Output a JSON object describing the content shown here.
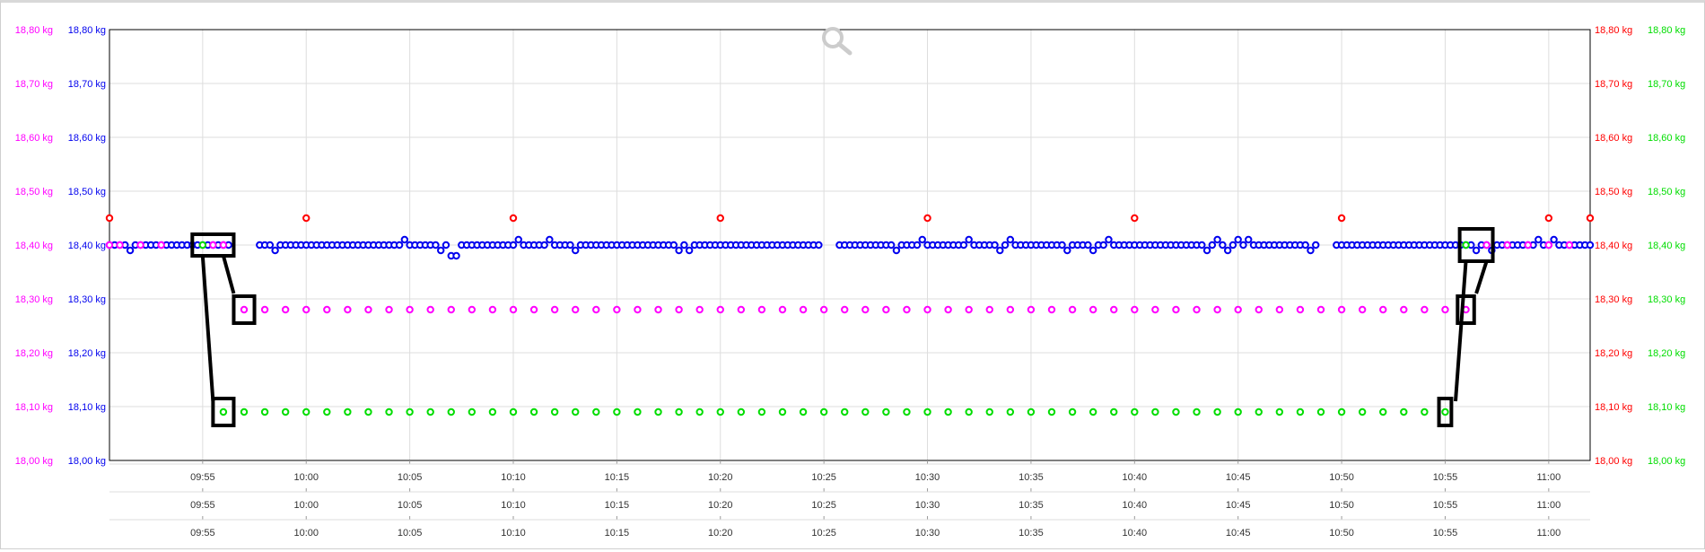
{
  "colors": {
    "axis_left_outer": "#ff00ff",
    "axis_left_inner": "#0000ee",
    "axis_right_inner": "#ff0000",
    "axis_right_outer": "#00dd00",
    "series_blue": "#0000ee",
    "series_magenta": "#ff00ff",
    "series_green": "#00dd00",
    "series_red": "#ff0000",
    "annotation": "#000000",
    "grid": "#dddddd"
  },
  "icons": {
    "zoom": "magnifier-icon"
  },
  "chart_data": {
    "type": "scatter",
    "x_unit": "time",
    "x_range": [
      "09:50:30",
      "11:02:00"
    ],
    "x_ticks": [
      "09:55",
      "10:00",
      "10:05",
      "10:10",
      "10:15",
      "10:20",
      "10:25",
      "10:30",
      "10:35",
      "10:40",
      "10:45",
      "10:50",
      "10:55",
      "11:00"
    ],
    "x_axis_rows": 3,
    "y_range": [
      18.0,
      18.8
    ],
    "y_ticks": [
      "18,00 kg",
      "18,10 kg",
      "18,20 kg",
      "18,30 kg",
      "18,40 kg",
      "18,50 kg",
      "18,60 kg",
      "18,70 kg",
      "18,80 kg"
    ],
    "y_axes": [
      {
        "side": "left",
        "position": "outer",
        "color": "#ff00ff"
      },
      {
        "side": "left",
        "position": "inner",
        "color": "#0000ee"
      },
      {
        "side": "right",
        "position": "inner",
        "color": "#ff0000"
      },
      {
        "side": "right",
        "position": "outer",
        "color": "#00dd00"
      }
    ],
    "grid": true,
    "legend": "none",
    "series": [
      {
        "color": "#ff0000",
        "marker": "circle",
        "points": [
          [
            "09:50:30",
            18.45
          ],
          [
            "10:00:00",
            18.45
          ],
          [
            "10:10:00",
            18.45
          ],
          [
            "10:20:00",
            18.45
          ],
          [
            "10:30:00",
            18.45
          ],
          [
            "10:40:00",
            18.45
          ],
          [
            "10:50:00",
            18.45
          ],
          [
            "11:00:00",
            18.45
          ],
          [
            "11:02:00",
            18.45
          ]
        ]
      },
      {
        "color": "#ff00ff",
        "marker": "circle",
        "points": [
          [
            "09:50:30",
            18.4
          ],
          [
            "09:51:00",
            18.4
          ],
          [
            "09:52:00",
            18.4
          ],
          [
            "09:53:00",
            18.4
          ],
          [
            "09:55:30",
            18.4
          ],
          [
            "09:56:00",
            18.4
          ],
          [
            "09:57:00",
            18.28
          ],
          [
            "09:58:00",
            18.28
          ],
          [
            "09:59:00",
            18.28
          ],
          [
            "10:00:00",
            18.28
          ],
          [
            "10:01:00",
            18.28
          ],
          [
            "10:02:00",
            18.28
          ],
          [
            "10:03:00",
            18.28
          ],
          [
            "10:04:00",
            18.28
          ],
          [
            "10:05:00",
            18.28
          ],
          [
            "10:06:00",
            18.28
          ],
          [
            "10:07:00",
            18.28
          ],
          [
            "10:08:00",
            18.28
          ],
          [
            "10:09:00",
            18.28
          ],
          [
            "10:10:00",
            18.28
          ],
          [
            "10:11:00",
            18.28
          ],
          [
            "10:12:00",
            18.28
          ],
          [
            "10:13:00",
            18.28
          ],
          [
            "10:14:00",
            18.28
          ],
          [
            "10:15:00",
            18.28
          ],
          [
            "10:16:00",
            18.28
          ],
          [
            "10:17:00",
            18.28
          ],
          [
            "10:18:00",
            18.28
          ],
          [
            "10:19:00",
            18.28
          ],
          [
            "10:20:00",
            18.28
          ],
          [
            "10:21:00",
            18.28
          ],
          [
            "10:22:00",
            18.28
          ],
          [
            "10:23:00",
            18.28
          ],
          [
            "10:24:00",
            18.28
          ],
          [
            "10:25:00",
            18.28
          ],
          [
            "10:26:00",
            18.28
          ],
          [
            "10:27:00",
            18.28
          ],
          [
            "10:28:00",
            18.28
          ],
          [
            "10:29:00",
            18.28
          ],
          [
            "10:30:00",
            18.28
          ],
          [
            "10:31:00",
            18.28
          ],
          [
            "10:32:00",
            18.28
          ],
          [
            "10:33:00",
            18.28
          ],
          [
            "10:34:00",
            18.28
          ],
          [
            "10:35:00",
            18.28
          ],
          [
            "10:36:00",
            18.28
          ],
          [
            "10:37:00",
            18.28
          ],
          [
            "10:38:00",
            18.28
          ],
          [
            "10:39:00",
            18.28
          ],
          [
            "10:40:00",
            18.28
          ],
          [
            "10:41:00",
            18.28
          ],
          [
            "10:42:00",
            18.28
          ],
          [
            "10:43:00",
            18.28
          ],
          [
            "10:44:00",
            18.28
          ],
          [
            "10:45:00",
            18.28
          ],
          [
            "10:46:00",
            18.28
          ],
          [
            "10:47:00",
            18.28
          ],
          [
            "10:48:00",
            18.28
          ],
          [
            "10:49:00",
            18.28
          ],
          [
            "10:50:00",
            18.28
          ],
          [
            "10:51:00",
            18.28
          ],
          [
            "10:52:00",
            18.28
          ],
          [
            "10:53:00",
            18.28
          ],
          [
            "10:54:00",
            18.28
          ],
          [
            "10:55:00",
            18.28
          ],
          [
            "10:56:00",
            18.28
          ],
          [
            "10:57:00",
            18.4
          ],
          [
            "10:58:00",
            18.4
          ],
          [
            "10:59:00",
            18.4
          ],
          [
            "11:00:00",
            18.4
          ],
          [
            "11:01:00",
            18.4
          ]
        ]
      },
      {
        "color": "#00dd00",
        "marker": "circle",
        "points": [
          [
            "09:55:00",
            18.4
          ],
          [
            "09:56:00",
            18.09
          ],
          [
            "09:57:00",
            18.09
          ],
          [
            "09:58:00",
            18.09
          ],
          [
            "09:59:00",
            18.09
          ],
          [
            "10:00:00",
            18.09
          ],
          [
            "10:01:00",
            18.09
          ],
          [
            "10:02:00",
            18.09
          ],
          [
            "10:03:00",
            18.09
          ],
          [
            "10:04:00",
            18.09
          ],
          [
            "10:05:00",
            18.09
          ],
          [
            "10:06:00",
            18.09
          ],
          [
            "10:07:00",
            18.09
          ],
          [
            "10:08:00",
            18.09
          ],
          [
            "10:09:00",
            18.09
          ],
          [
            "10:10:00",
            18.09
          ],
          [
            "10:11:00",
            18.09
          ],
          [
            "10:12:00",
            18.09
          ],
          [
            "10:13:00",
            18.09
          ],
          [
            "10:14:00",
            18.09
          ],
          [
            "10:15:00",
            18.09
          ],
          [
            "10:16:00",
            18.09
          ],
          [
            "10:17:00",
            18.09
          ],
          [
            "10:18:00",
            18.09
          ],
          [
            "10:19:00",
            18.09
          ],
          [
            "10:20:00",
            18.09
          ],
          [
            "10:21:00",
            18.09
          ],
          [
            "10:22:00",
            18.09
          ],
          [
            "10:23:00",
            18.09
          ],
          [
            "10:24:00",
            18.09
          ],
          [
            "10:25:00",
            18.09
          ],
          [
            "10:26:00",
            18.09
          ],
          [
            "10:27:00",
            18.09
          ],
          [
            "10:28:00",
            18.09
          ],
          [
            "10:29:00",
            18.09
          ],
          [
            "10:30:00",
            18.09
          ],
          [
            "10:31:00",
            18.09
          ],
          [
            "10:32:00",
            18.09
          ],
          [
            "10:33:00",
            18.09
          ],
          [
            "10:34:00",
            18.09
          ],
          [
            "10:35:00",
            18.09
          ],
          [
            "10:36:00",
            18.09
          ],
          [
            "10:37:00",
            18.09
          ],
          [
            "10:38:00",
            18.09
          ],
          [
            "10:39:00",
            18.09
          ],
          [
            "10:40:00",
            18.09
          ],
          [
            "10:41:00",
            18.09
          ],
          [
            "10:42:00",
            18.09
          ],
          [
            "10:43:00",
            18.09
          ],
          [
            "10:44:00",
            18.09
          ],
          [
            "10:45:00",
            18.09
          ],
          [
            "10:46:00",
            18.09
          ],
          [
            "10:47:00",
            18.09
          ],
          [
            "10:48:00",
            18.09
          ],
          [
            "10:49:00",
            18.09
          ],
          [
            "10:50:00",
            18.09
          ],
          [
            "10:51:00",
            18.09
          ],
          [
            "10:52:00",
            18.09
          ],
          [
            "10:53:00",
            18.09
          ],
          [
            "10:54:00",
            18.09
          ],
          [
            "10:55:00",
            18.09
          ],
          [
            "10:56:00",
            18.4
          ]
        ]
      },
      {
        "color": "#0000ee",
        "marker": "circle",
        "base_value": 18.4,
        "time_range": [
          "09:50:30",
          "11:02:00"
        ],
        "interval_seconds": 15,
        "gaps": [
          [
            "09:56:30",
            "09:57:30"
          ],
          [
            "10:25:00",
            "10:25:30"
          ],
          [
            "10:49:00",
            "10:49:30"
          ]
        ],
        "outliers": [
          [
            "09:51:30",
            18.39
          ],
          [
            "09:58:30",
            18.39
          ],
          [
            "10:04:45",
            18.41
          ],
          [
            "10:06:30",
            18.39
          ],
          [
            "10:07:00",
            18.38
          ],
          [
            "10:07:15",
            18.38
          ],
          [
            "10:10:15",
            18.41
          ],
          [
            "10:11:45",
            18.41
          ],
          [
            "10:13:00",
            18.39
          ],
          [
            "10:18:00",
            18.39
          ],
          [
            "10:18:30",
            18.39
          ],
          [
            "10:28:30",
            18.39
          ],
          [
            "10:29:45",
            18.41
          ],
          [
            "10:32:00",
            18.41
          ],
          [
            "10:33:30",
            18.39
          ],
          [
            "10:34:00",
            18.41
          ],
          [
            "10:36:45",
            18.39
          ],
          [
            "10:38:00",
            18.39
          ],
          [
            "10:38:45",
            18.41
          ],
          [
            "10:43:30",
            18.39
          ],
          [
            "10:44:00",
            18.41
          ],
          [
            "10:44:30",
            18.39
          ],
          [
            "10:45:00",
            18.41
          ],
          [
            "10:45:30",
            18.41
          ],
          [
            "10:48:30",
            18.39
          ],
          [
            "10:56:30",
            18.39
          ],
          [
            "10:57:15",
            18.39
          ],
          [
            "10:59:30",
            18.41
          ],
          [
            "11:00:15",
            18.41
          ]
        ]
      }
    ],
    "annotations": [
      {
        "type": "box",
        "time": "09:55:30",
        "value": 18.4,
        "width_minutes": 2.0,
        "height_kg": 0.04
      },
      {
        "type": "box",
        "time": "09:57:00",
        "value": 18.28,
        "width_minutes": 1.0,
        "height_kg": 0.05
      },
      {
        "type": "box",
        "time": "09:56:00",
        "value": 18.09,
        "width_minutes": 1.0,
        "height_kg": 0.05
      },
      {
        "type": "box",
        "time": "10:56:30",
        "value": 18.4,
        "width_minutes": 1.6,
        "height_kg": 0.06
      },
      {
        "type": "box",
        "time": "10:56:00",
        "value": 18.28,
        "width_minutes": 0.8,
        "height_kg": 0.05
      },
      {
        "type": "box",
        "time": "10:55:00",
        "value": 18.09,
        "width_minutes": 0.6,
        "height_kg": 0.05
      },
      {
        "type": "line",
        "from": [
          "09:55:00",
          18.38
        ],
        "to": [
          "09:55:30",
          18.11
        ]
      },
      {
        "type": "line",
        "from": [
          "09:56:00",
          18.38
        ],
        "to": [
          "09:56:30",
          18.31
        ]
      },
      {
        "type": "line",
        "from": [
          "10:56:00",
          18.37
        ],
        "to": [
          "10:55:30",
          18.11
        ]
      },
      {
        "type": "line",
        "from": [
          "10:57:00",
          18.37
        ],
        "to": [
          "10:56:30",
          18.31
        ]
      }
    ]
  }
}
